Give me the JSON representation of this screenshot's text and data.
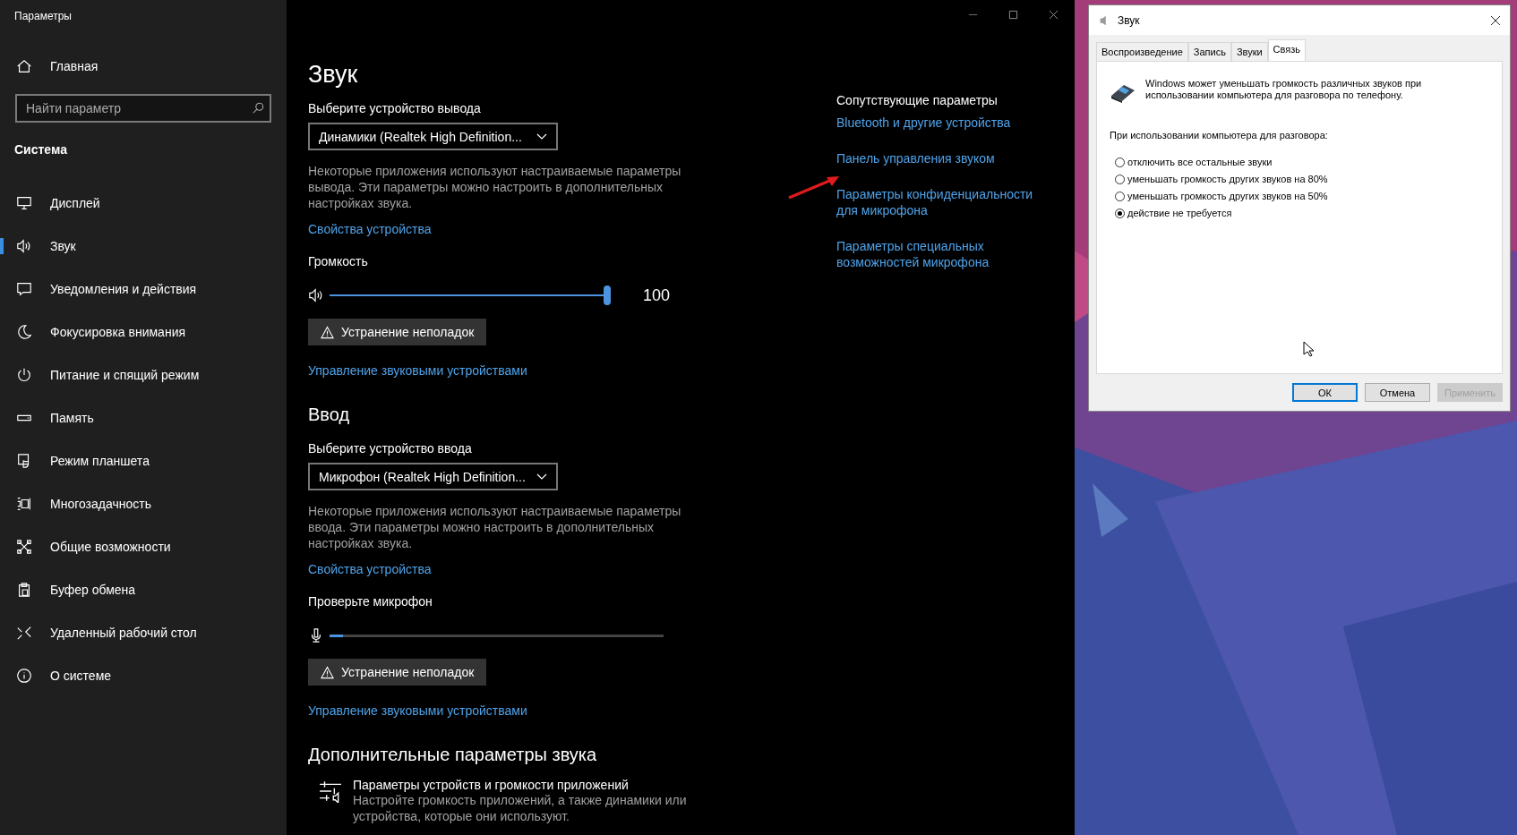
{
  "settings": {
    "title": "Параметры",
    "home": "Главная",
    "search": {
      "placeholder": "Найти параметр"
    },
    "section": "Система",
    "items": [
      {
        "label": "Дисплей",
        "kind": "display",
        "selected": false
      },
      {
        "label": "Звук",
        "kind": "sound",
        "selected": true
      },
      {
        "label": "Уведомления и действия",
        "kind": "notify",
        "selected": false
      },
      {
        "label": "Фокусировка внимания",
        "kind": "moon",
        "selected": false
      },
      {
        "label": "Питание и спящий режим",
        "kind": "power",
        "selected": false
      },
      {
        "label": "Память",
        "kind": "storage",
        "selected": false
      },
      {
        "label": "Режим планшета",
        "kind": "tablet",
        "selected": false
      },
      {
        "label": "Многозадачность",
        "kind": "multitask",
        "selected": false
      },
      {
        "label": "Общие возможности",
        "kind": "share",
        "selected": false
      },
      {
        "label": "Буфер обмена",
        "kind": "clipboard",
        "selected": false
      },
      {
        "label": "Удаленный рабочий стол",
        "kind": "remote",
        "selected": false
      },
      {
        "label": "О системе",
        "kind": "info",
        "selected": false
      }
    ]
  },
  "page": {
    "title": "Звук",
    "output": {
      "label": "Выберите устройство вывода",
      "device": "Динамики (Realtek High Definition...",
      "note": "Некоторые приложения используют настраиваемые параметры вывода. Эти параметры можно настроить в дополнительных настройках звука.",
      "link": "Свойства устройства",
      "volume_label": "Громкость",
      "level": 1.0,
      "reading": "100",
      "troubleshoot": "Устранение неполадок",
      "manage": "Управление звуковыми устройствами"
    },
    "input_heading": "Ввод",
    "input": {
      "label": "Выберите устройство ввода",
      "device": "Микрофон (Realtek High Definition...",
      "note": "Некоторые приложения используют настраиваемые параметры ввода. Эти параметры можно настроить в дополнительных настройках звука.",
      "link": "Свойства устройства",
      "test_label": "Проверьте микрофон",
      "level": 0.04,
      "troubleshoot": "Устранение неполадок",
      "manage": "Управление звуковыми устройствами"
    },
    "advanced_heading": "Дополнительные параметры звука",
    "advanced": {
      "title": "Параметры устройств и громкости приложений",
      "description": "Настройте громкость приложений, а также динамики или устройства, которые они используют."
    },
    "related": {
      "heading": "Сопутствующие параметры",
      "links": [
        "Bluetooth и другие устройства",
        "Панель управления звуком",
        "Параметры конфиденциальности для микрофона",
        "Параметры специальных возможностей микрофона"
      ]
    }
  },
  "dialog": {
    "title": "Звук",
    "tabs": [
      {
        "label": "Воспроизведение",
        "selected": false
      },
      {
        "label": "Запись",
        "selected": false
      },
      {
        "label": "Звуки",
        "selected": false
      },
      {
        "label": "Связь",
        "selected": true
      }
    ],
    "intro": "Windows может уменьшать громкость различных звуков при использовании компьютера для разговора по телефону.",
    "question": "При использовании компьютера для разговора:",
    "options": [
      {
        "label": "отключить все остальные звуки",
        "selected": false
      },
      {
        "label": "уменьшать громкость других звуков на 80%",
        "selected": false
      },
      {
        "label": "уменьшать громкость других звуков на 50%",
        "selected": false
      },
      {
        "label": "действие не требуется",
        "selected": true
      }
    ],
    "buttons": [
      {
        "label": "ОК",
        "kind": "default",
        "disabled": false
      },
      {
        "label": "Отмена",
        "kind": "normal",
        "disabled": false
      },
      {
        "label": "Применить",
        "kind": "normal",
        "disabled": true
      }
    ]
  }
}
